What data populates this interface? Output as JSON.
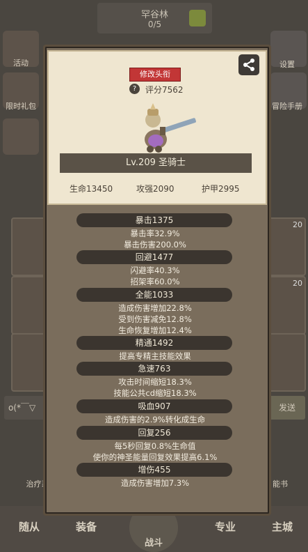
{
  "background": {
    "map_name": "罕谷林",
    "map_progress": "0/5",
    "left_labels": [
      "活动",
      "限时礼包",
      ""
    ],
    "right_labels": [
      "设置",
      "冒险手册"
    ],
    "card_counts": [
      "20",
      "20"
    ],
    "chat_input": "o(*￣▽",
    "send_label": "发送",
    "heal_label": "治疗系",
    "skill_label": "能书",
    "nav": {
      "followers": "随从",
      "equipment": "装备",
      "battle": "战斗",
      "profession": "专业",
      "city": "主城"
    }
  },
  "popup": {
    "title_button": "修改头衔",
    "score": "评分7562",
    "level_class": "Lv.209 圣骑士",
    "hp": "生命13450",
    "attack": "攻强2090",
    "armor": "护甲2995",
    "sections": [
      {
        "header": "暴击1375",
        "lines": [
          "暴击率32.9%",
          "暴击伤害200.0%"
        ]
      },
      {
        "header": "回避1477",
        "lines": [
          "闪避率40.3%",
          "招架率60.0%"
        ]
      },
      {
        "header": "全能1033",
        "lines": [
          "造成伤害增加22.8%",
          "受到伤害减免12.8%",
          "生命恢复增加12.4%"
        ]
      },
      {
        "header": "精通1492",
        "lines": [
          "提高专精主技能效果"
        ]
      },
      {
        "header": "急速763",
        "lines": [
          "攻击时间缩短18.3%",
          "技能公共cd缩短18.3%"
        ]
      },
      {
        "header": "吸血907",
        "lines": [
          "造成伤害的2.9%转化成生命"
        ]
      },
      {
        "header": "回复256",
        "lines": [
          "每5秒回复0.8%生命值",
          "使你的神圣能量回复效果提高6.1%"
        ]
      },
      {
        "header": "增伤455",
        "lines": [
          "造成伤害增加7.3%"
        ]
      }
    ]
  },
  "colors": {
    "title_button": "#c23636",
    "panel": "#efe6d0",
    "popup": "#7a6d5c",
    "bar": "#3b352f"
  }
}
